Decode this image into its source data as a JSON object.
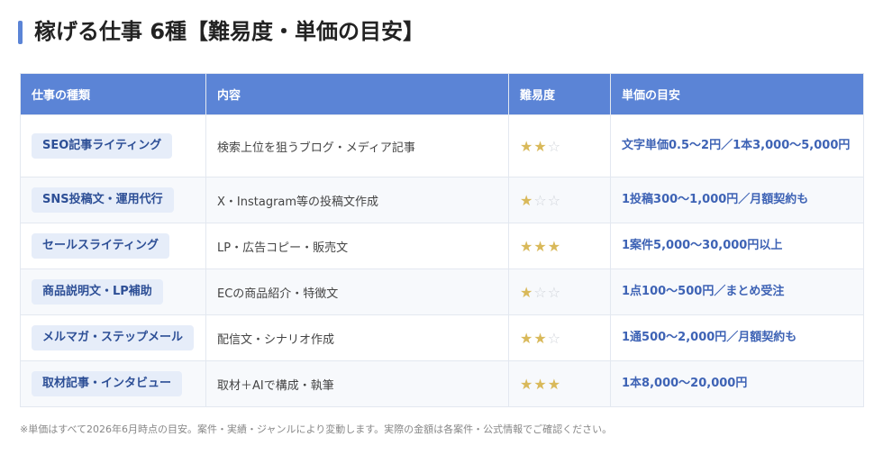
{
  "heading": "稼げる仕事 6種【難易度・単価の目安】",
  "table": {
    "headers": [
      "仕事の種類",
      "内容",
      "難易度",
      "単価の目安"
    ],
    "rows": [
      {
        "job": "SEO記事ライティング",
        "content": "検索上位を狙うブログ・メディア記事",
        "difficulty": 2,
        "price": "文字単価0.5〜2円／1本3,000〜5,000円"
      },
      {
        "job": "SNS投稿文・運用代行",
        "content": "X・Instagram等の投稿文作成",
        "difficulty": 1,
        "price": "1投稿300〜1,000円／月額契約も"
      },
      {
        "job": "セールスライティング",
        "content": "LP・広告コピー・販売文",
        "difficulty": 3,
        "price": "1案件5,000〜30,000円以上"
      },
      {
        "job": "商品説明文・LP補助",
        "content": "ECの商品紹介・特徴文",
        "difficulty": 1,
        "price": "1点100〜500円／まとめ受注"
      },
      {
        "job": "メルマガ・ステップメール",
        "content": "配信文・シナリオ作成",
        "difficulty": 2,
        "price": "1通500〜2,000円／月額契約も"
      },
      {
        "job": "取材記事・インタビュー",
        "content": "取材＋AIで構成・執筆",
        "difficulty": 3,
        "price": "1本8,000〜20,000円"
      }
    ],
    "star_max": 5
  },
  "footnote": "※単価はすべて2026年6月時点の目安。案件・実績・ジャンルにより変動します。実際の金額は各案件・公式情報でご確認ください。",
  "colors": {
    "accent": "#5b84d6",
    "badge_bg": "#e6edf9",
    "badge_text": "#2d4f96",
    "star_on": "#d9b95a",
    "star_off": "#d0d4da",
    "price_text": "#3e63b5"
  }
}
